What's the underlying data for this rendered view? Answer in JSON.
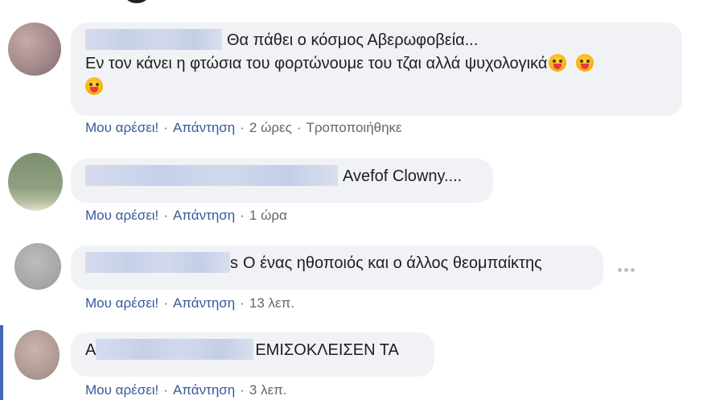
{
  "comments": [
    {
      "text_line1": "Θα πάθει ο κόσμος Αβερωφοβεία...",
      "text_line2": "Εν τον κάνει η φτώσια του φορτώνουμε του τζαι αλλά ψυχολογικά",
      "like": "Μου αρέσει!",
      "reply": "Απάντηση",
      "time": "2 ώρες",
      "edited": "Τροποποιήθηκε",
      "avatar_color": "#a38a8c"
    },
    {
      "text": "Avefof Clowny....",
      "like": "Μου αρέσει!",
      "reply": "Απάντηση",
      "time": "1 ώρα",
      "avatar_color": "#8a9a7a"
    },
    {
      "text_prefix": "s",
      "text": "Ο ένας ηθοποιός και ο άλλος θεομπαίκτης",
      "like": "Μου αρέσει!",
      "reply": "Απάντηση",
      "time": "13 λεπ.",
      "avatar_color": "#a8a8a8"
    },
    {
      "text_prefix": "Α",
      "text": "ΕΜΙΣΟΚΛΕΙΣΕΝ ΤΑ",
      "like": "Μου αρέσει!",
      "reply": "Απάντηση",
      "time": "3 λεπ.",
      "avatar_color": "#b09a94"
    }
  ],
  "icons": {
    "emoji": "tongue-out-emoji-icon",
    "more": "more-options-icon"
  }
}
